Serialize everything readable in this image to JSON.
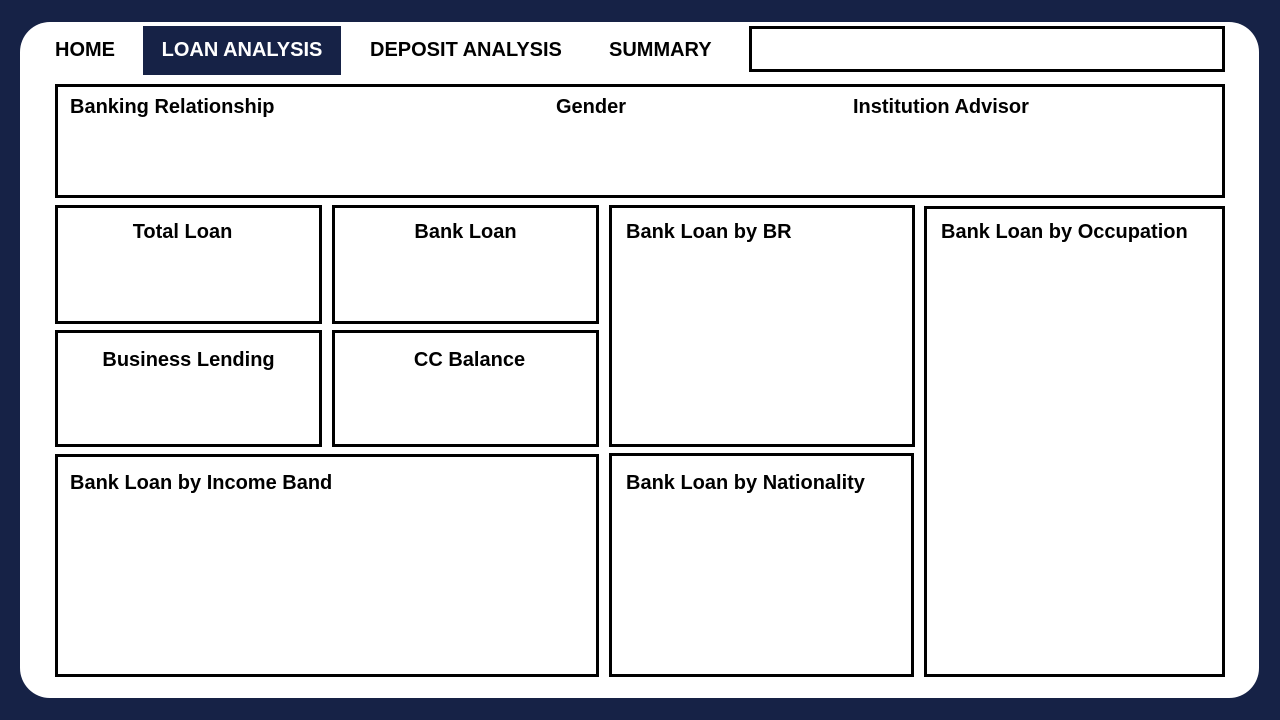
{
  "nav": {
    "tabs": [
      {
        "label": "HOME"
      },
      {
        "label": "LOAN ANALYSIS",
        "active": true
      },
      {
        "label": "DEPOSIT ANALYSIS"
      },
      {
        "label": "SUMMARY"
      }
    ],
    "search": {
      "value": "",
      "placeholder": ""
    }
  },
  "filters": {
    "banking_relationship": "Banking Relationship",
    "gender": "Gender",
    "institution_advisor": "Institution Advisor"
  },
  "kpis": {
    "total_loan": "Total Loan",
    "bank_loan": "Bank Loan",
    "business_lending": "Business Lending",
    "cc_balance": "CC Balance"
  },
  "charts": {
    "by_br": "Bank Loan by BR",
    "by_occupation": "Bank Loan by Occupation",
    "by_income_band": "Bank Loan by Income Band",
    "by_nationality": "Bank Loan by Nationality"
  },
  "colors": {
    "background": "#162246",
    "active_tab": "#162246",
    "panel": "#ffffff",
    "border": "#000000"
  }
}
